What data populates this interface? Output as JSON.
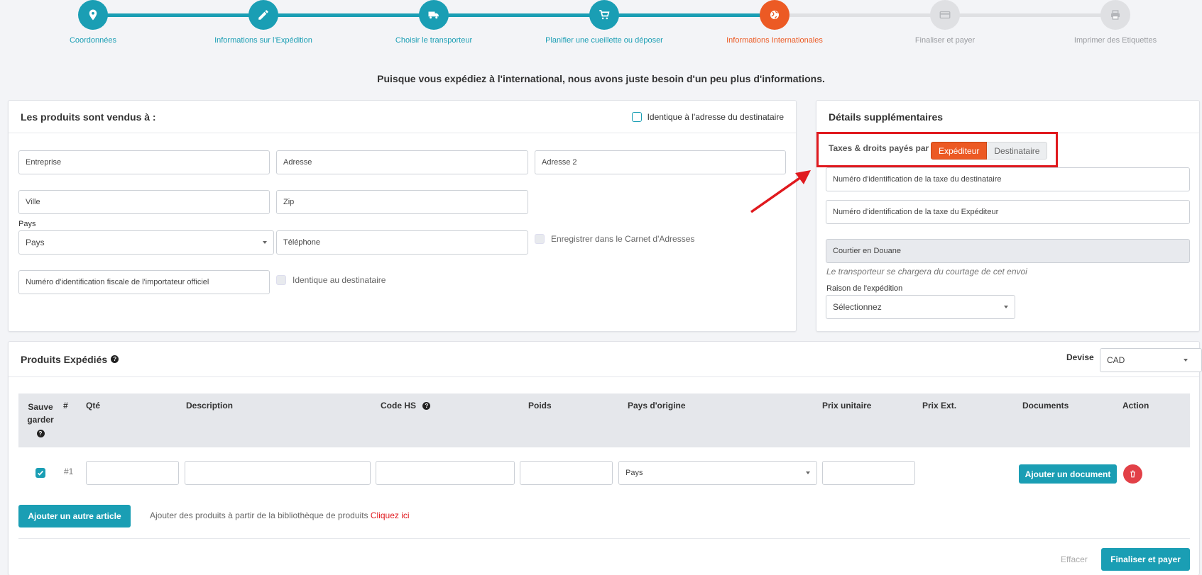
{
  "stepper": {
    "steps": [
      {
        "label": "Coordonnées",
        "icon": "map-marker-icon",
        "state": "done"
      },
      {
        "label": "Informations sur l'Expédition",
        "icon": "pencil-icon",
        "state": "done"
      },
      {
        "label": "Choisir le transporteur",
        "icon": "truck-icon",
        "state": "done"
      },
      {
        "label": "Planifier une cueillette ou déposer",
        "icon": "cart-icon",
        "state": "done"
      },
      {
        "label": "Informations Internationales",
        "icon": "globe-icon",
        "state": "active"
      },
      {
        "label": "Finaliser et payer",
        "icon": "credit-card-icon",
        "state": "todo"
      },
      {
        "label": "Imprimer des Etiquettes",
        "icon": "printer-icon",
        "state": "todo"
      }
    ]
  },
  "intro": "Puisque vous expédiez à l'international, nous avons juste besoin d'un peu plus d'informations.",
  "sold_to": {
    "title": "Les produits sont vendus à :",
    "same_as_recipient_label": "Identique à l'adresse du destinataire",
    "company_placeholder": "Entreprise",
    "address_placeholder": "Adresse",
    "address2_placeholder": "Adresse 2",
    "city_placeholder": "Ville",
    "zip_placeholder": "Zip",
    "country_label": "Pays",
    "country_value": "Pays",
    "phone_placeholder": "Téléphone",
    "save_address_book_label": "Enregistrer dans le Carnet d'Adresses",
    "importer_tax_id_placeholder": "Numéro d'identification fiscale de l'importateur officiel",
    "identical_recipient_label": "Identique au destinataire"
  },
  "details": {
    "title": "Détails supplémentaires",
    "duties_paid_by_label": "Taxes & droits payés par",
    "duties_options": [
      "Expéditeur",
      "Destinataire"
    ],
    "duties_selected": "Expéditeur",
    "recipient_tax_id_placeholder": "Numéro d'identification de la taxe du destinataire",
    "shipper_tax_id_placeholder": "Numéro d'identification de la taxe du Expéditeur",
    "customs_broker_placeholder": "Courtier en Douane",
    "broker_note": "Le transporteur se chargera du courtage de cet envoi",
    "reason_label": "Raison de l'expédition",
    "reason_value": "Sélectionnez"
  },
  "products": {
    "title": "Produits Expédiés",
    "currency_label": "Devise",
    "currency_value": "CAD",
    "columns": {
      "save": "Sauvegarder",
      "num": "#",
      "qty": "Qté",
      "description": "Description",
      "hs_code": "Code HS",
      "weight": "Poids",
      "origin": "Pays d'origine",
      "unit_price": "Prix unitaire",
      "ext_price": "Prix Ext.",
      "documents": "Documents",
      "action": "Action"
    },
    "rows": [
      {
        "num": "#1",
        "origin_value": "Pays",
        "add_document_label": "Ajouter un document"
      }
    ],
    "add_item_label": "Ajouter un autre article",
    "library_text": "Ajouter des produits à partir de la bibliothèque de produits",
    "library_link": "Cliquez ici",
    "clear_label": "Effacer",
    "finalize_label": "Finaliser et payer"
  },
  "colors": {
    "teal": "#1a9eb4",
    "orange": "#ec5a24",
    "gray": "#d6d8dc",
    "highlight_red": "#e0191e"
  }
}
